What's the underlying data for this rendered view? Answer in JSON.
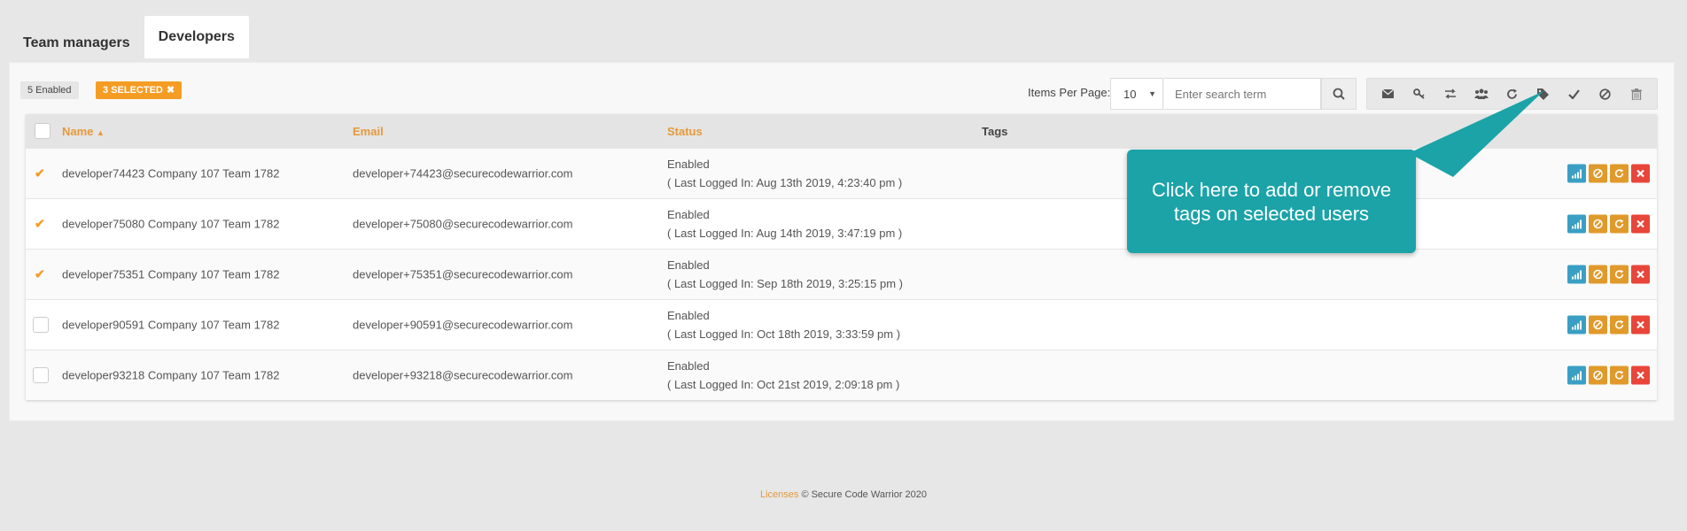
{
  "tabs": [
    {
      "label": "Team managers",
      "active": false
    },
    {
      "label": "Developers",
      "active": true
    }
  ],
  "toolbar": {
    "enabled_badge": "5 Enabled",
    "selected_badge": "3 SELECTED",
    "items_per_page_label": "Items Per Page:",
    "items_per_page_value": "10",
    "search_placeholder": "Enter search term"
  },
  "action_icons": [
    "envelope-icon",
    "key-icon",
    "transfer-icon",
    "group-icon",
    "refresh-icon",
    "tag-icon",
    "check-icon",
    "block-icon",
    "trash-icon"
  ],
  "table": {
    "columns": [
      "Name",
      "Email",
      "Status",
      "Tags"
    ],
    "sort_column": "Name",
    "sort_direction": "asc",
    "rows": [
      {
        "selected": true,
        "name": "developer74423 Company 107 Team 1782",
        "email": "developer+74423@securecodewarrior.com",
        "status": "Enabled",
        "last_login": "( Last Logged In: Aug 13th 2019, 4:23:40 pm )"
      },
      {
        "selected": true,
        "name": "developer75080 Company 107 Team 1782",
        "email": "developer+75080@securecodewarrior.com",
        "status": "Enabled",
        "last_login": "( Last Logged In: Aug 14th 2019, 3:47:19 pm )"
      },
      {
        "selected": true,
        "name": "developer75351 Company 107 Team 1782",
        "email": "developer+75351@securecodewarrior.com",
        "status": "Enabled",
        "last_login": "( Last Logged In: Sep 18th 2019, 3:25:15 pm )"
      },
      {
        "selected": false,
        "name": "developer90591 Company 107 Team 1782",
        "email": "developer+90591@securecodewarrior.com",
        "status": "Enabled",
        "last_login": "( Last Logged In: Oct 18th 2019, 3:33:59 pm )"
      },
      {
        "selected": false,
        "name": "developer93218 Company 107 Team 1782",
        "email": "developer+93218@securecodewarrior.com",
        "status": "Enabled",
        "last_login": "( Last Logged In: Oct 21st 2019, 2:09:18 pm )"
      }
    ]
  },
  "row_action_icons": [
    "stats-icon",
    "block-icon",
    "reset-icon",
    "delete-icon"
  ],
  "callout": {
    "text": "Click here to add or remove tags on selected users"
  },
  "footer": {
    "link": "Licenses",
    "text": "© Secure Code Warrior 2020"
  },
  "colors": {
    "accent": "#f59c23",
    "callout": "#1ba3a8",
    "stats": "#3a9fc4",
    "block": "#e09a2b",
    "reset": "#e09a2b",
    "delete": "#e8463a"
  }
}
